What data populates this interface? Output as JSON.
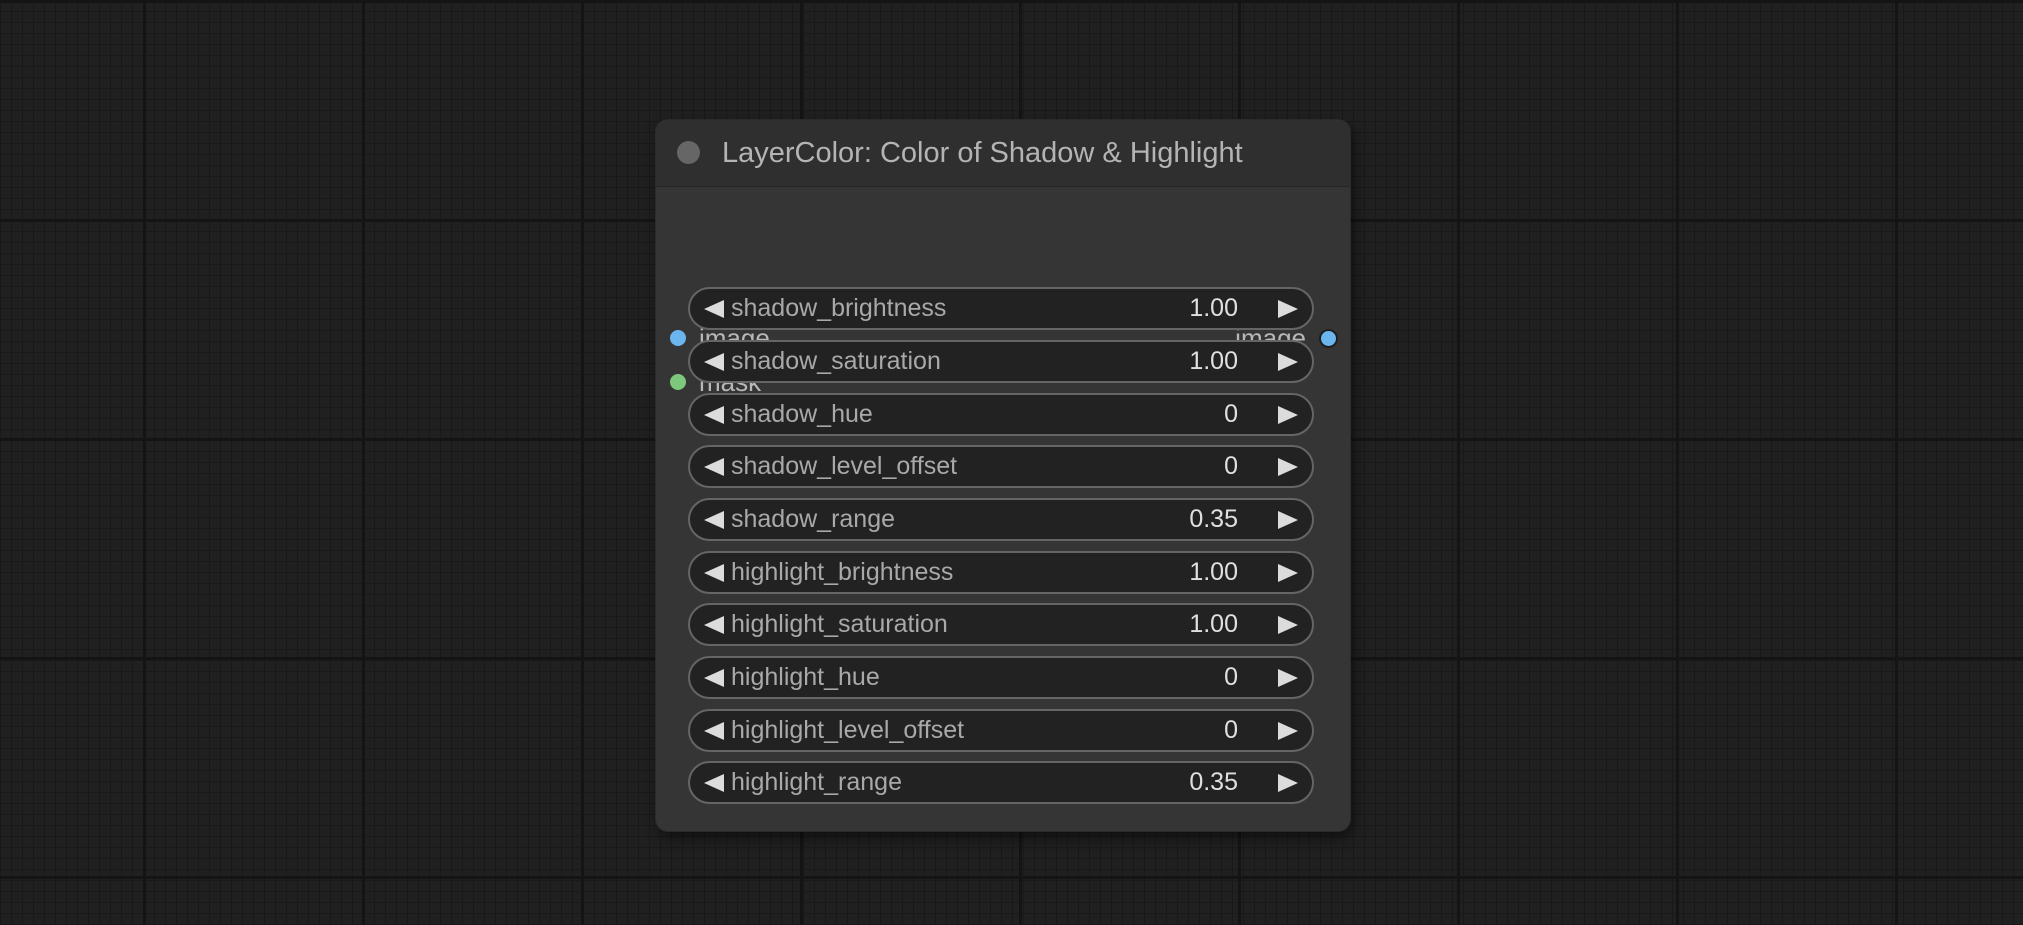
{
  "node": {
    "title": "LayerColor: Color of Shadow & Highlight",
    "inputs": [
      {
        "label": "image",
        "color": "#6cb6f0"
      },
      {
        "label": "mask",
        "color": "#7ec87e"
      }
    ],
    "outputs": [
      {
        "label": "image",
        "color": "#6cb6f0"
      }
    ],
    "widgets": [
      {
        "label": "shadow_brightness",
        "value": "1.00"
      },
      {
        "label": "shadow_saturation",
        "value": "1.00"
      },
      {
        "label": "shadow_hue",
        "value": "0"
      },
      {
        "label": "shadow_level_offset",
        "value": "0"
      },
      {
        "label": "shadow_range",
        "value": "0.35"
      },
      {
        "label": "highlight_brightness",
        "value": "1.00"
      },
      {
        "label": "highlight_saturation",
        "value": "1.00"
      },
      {
        "label": "highlight_hue",
        "value": "0"
      },
      {
        "label": "highlight_level_offset",
        "value": "0"
      },
      {
        "label": "highlight_range",
        "value": "0.35"
      }
    ]
  },
  "colors": {
    "canvas": "#202020",
    "node_body": "#353535",
    "node_header": "#2f2f2f",
    "widget_bg": "#222222",
    "widget_border": "#656565"
  }
}
